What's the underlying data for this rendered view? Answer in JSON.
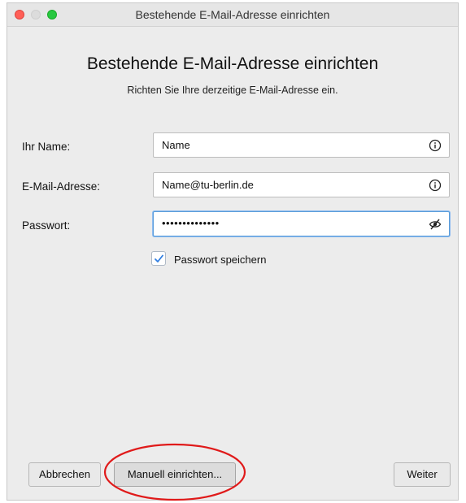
{
  "window": {
    "title": "Bestehende E-Mail-Adresse einrichten"
  },
  "dialog": {
    "heading": "Bestehende E-Mail-Adresse einrichten",
    "subheading": "Richten Sie Ihre derzeitige E-Mail-Adresse ein."
  },
  "form": {
    "name_label": "Ihr Name:",
    "name_value": "Name",
    "name_icon": "info-icon",
    "email_label": "E-Mail-Adresse:",
    "email_value": "Name@tu-berlin.de",
    "email_icon": "info-icon",
    "password_label": "Passwort:",
    "password_value": "••••••••••••••",
    "password_icon": "eye-slash-icon",
    "remember_label": "Passwort speichern",
    "remember_checked": true
  },
  "buttons": {
    "cancel_label": "Abbrechen",
    "manual_label": "Manuell einrichten...",
    "next_label": "Weiter"
  },
  "colors": {
    "close": "#ff5f57",
    "zoom": "#28c840",
    "focus": "#5b9dd9",
    "annotation": "#e01a1a"
  }
}
